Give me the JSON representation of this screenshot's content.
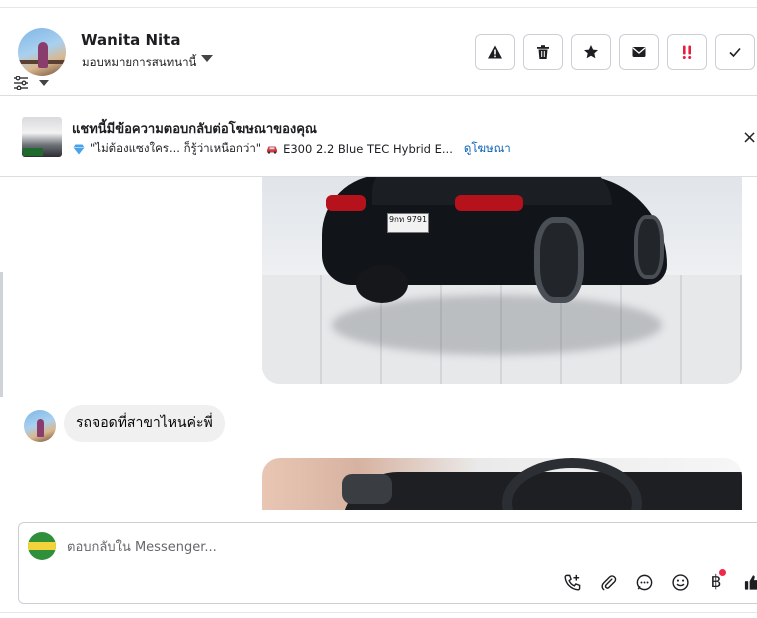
{
  "header": {
    "contact_name": "Wanita Nita",
    "assign_label": "มอบหมายการสนทนานี้",
    "toolbar": [
      {
        "name": "report-button",
        "icon": "warning-icon"
      },
      {
        "name": "delete-button",
        "icon": "trash-icon"
      },
      {
        "name": "star-button",
        "icon": "star-icon"
      },
      {
        "name": "mark-unread-button",
        "icon": "envelope-icon"
      },
      {
        "name": "priority-button",
        "icon": "priority-icon"
      },
      {
        "name": "done-button",
        "icon": "check-icon"
      }
    ]
  },
  "ad_banner": {
    "title": "แชทนี้มีข้อความตอบกลับต่อโฆษณาของคุณ",
    "quote": "\"ไม่ต้องแซงใคร... ก็รู้ว่าเหนือกว่า\"",
    "vehicle": "E300 2.2 Blue TEC Hybrid E...",
    "link_label": "ดูโฆษณา",
    "close_symbol": "×"
  },
  "messages": [
    {
      "type": "image",
      "sender": "contact",
      "plate_text": "9กท 9791"
    },
    {
      "type": "text",
      "sender": "contact",
      "text": "รถจอดที่สาขาไหนค่ะพี่"
    },
    {
      "type": "image",
      "sender": "contact"
    }
  ],
  "composer": {
    "placeholder": "ตอบกลับใน Messenger...",
    "baht_symbol": "฿"
  },
  "colors": {
    "accent_link": "#0a63b5",
    "priority_red": "#e41e3f",
    "bubble_bg": "#f0f0f0",
    "notification_dot": "#f02849"
  }
}
